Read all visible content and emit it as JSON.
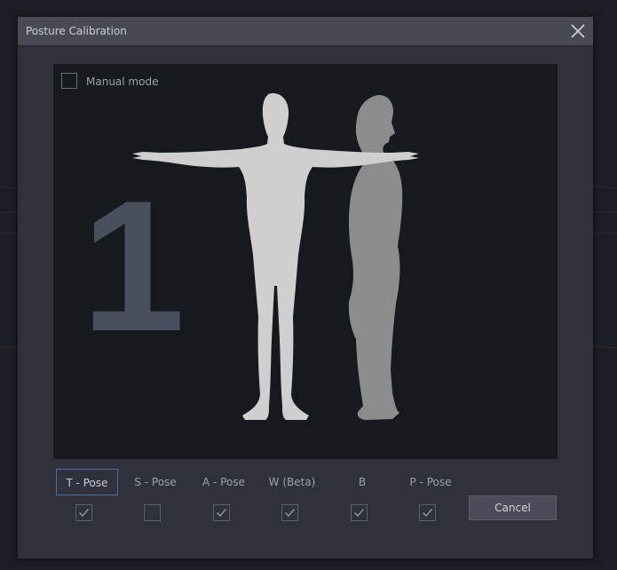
{
  "dialog": {
    "title": "Posture Calibration",
    "close_icon": "close-icon"
  },
  "viewport": {
    "manual_mode_label": "Manual mode",
    "manual_mode_checked": false,
    "step_number": "1"
  },
  "poses": [
    {
      "label": "T - Pose",
      "checked": true,
      "active": true
    },
    {
      "label": "S - Pose",
      "checked": false,
      "active": false
    },
    {
      "label": "A - Pose",
      "checked": true,
      "active": false
    },
    {
      "label": "W (Beta)",
      "checked": true,
      "active": false
    },
    {
      "label": "B",
      "checked": true,
      "active": false
    },
    {
      "label": "P - Pose",
      "checked": true,
      "active": false
    }
  ],
  "cancel_label": "Cancel",
  "colors": {
    "accent": "#4f6f9c",
    "front_figure": "#cfcfcf",
    "side_figure": "#8c8c8c",
    "step_number": "#4a4f5e"
  }
}
